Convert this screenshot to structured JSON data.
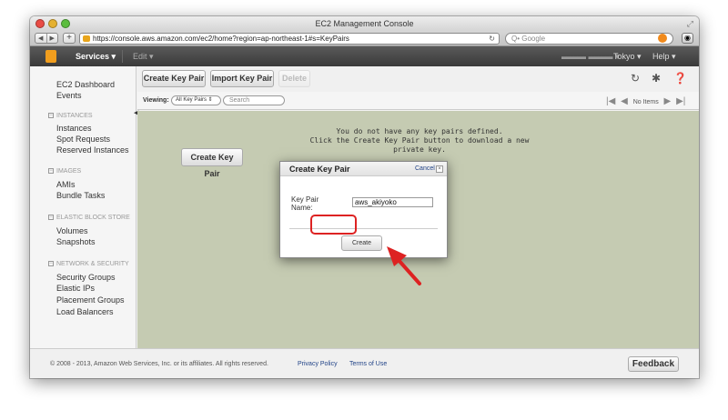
{
  "window": {
    "title": "EC2 Management Console",
    "url": "https://console.aws.amazon.com/ec2/home?region=ap-northeast-1#s=KeyPairs",
    "search_placeholder": "Q• Google"
  },
  "topnav": {
    "services": "Services ▾",
    "edit": "Edit ▾",
    "user": "▬▬▬ ▬▬▬ ▾",
    "region": "Tokyo ▾",
    "help": "Help ▾"
  },
  "sidebar": {
    "dashboard": "EC2 Dashboard",
    "events": "Events",
    "instances_head": "INSTANCES",
    "instances": [
      "Instances",
      "Spot Requests",
      "Reserved Instances"
    ],
    "images_head": "IMAGES",
    "images": [
      "AMIs",
      "Bundle Tasks"
    ],
    "ebs_head": "ELASTIC BLOCK STORE",
    "ebs": [
      "Volumes",
      "Snapshots"
    ],
    "netsec_head": "NETWORK & SECURITY",
    "netsec": [
      "Security Groups",
      "Elastic IPs",
      "Placement Groups",
      "Load Balancers"
    ]
  },
  "toolbar": {
    "create": "Create Key Pair",
    "import": "Import Key Pair",
    "delete": "Delete"
  },
  "filter": {
    "viewing_label": "Viewing:",
    "selected": "All Key Pairs",
    "search_placeholder": "Search",
    "pager_text": "No Items"
  },
  "grid": {
    "empty_line1": "You do not have any key pairs defined.",
    "empty_line2": "Click the Create Key Pair button to download a new private key.",
    "create_button": "Create Key Pair"
  },
  "modal": {
    "title": "Create Key Pair",
    "cancel": "Cancel",
    "field_label": "Key Pair Name:",
    "field_value": "aws_akiyoko",
    "create_button": "Create"
  },
  "footer": {
    "copyright": "© 2008 - 2013, Amazon Web Services, Inc. or its affiliates. All rights reserved.",
    "privacy": "Privacy Policy",
    "terms": "Terms of Use",
    "feedback": "Feedback"
  },
  "colors": {
    "highlight": "#dd2222",
    "grid_bg": "#c5cbb2",
    "nav_bg": "#3a3a3a"
  }
}
